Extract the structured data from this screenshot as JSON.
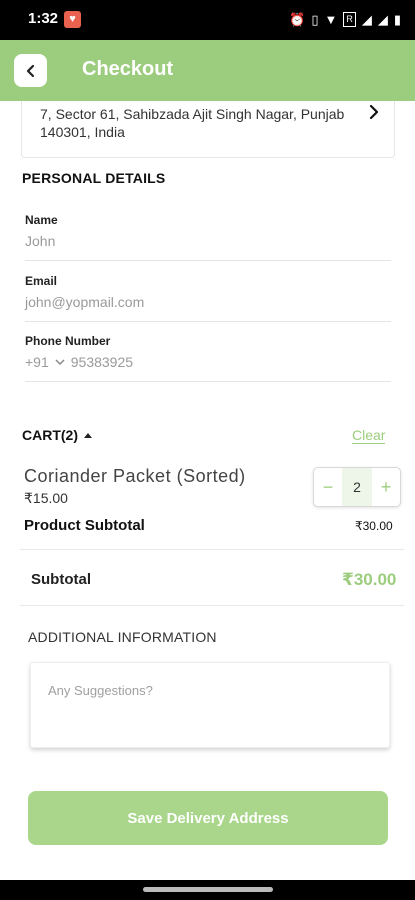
{
  "status_bar": {
    "time": "1:32",
    "network_label": "R"
  },
  "header": {
    "title": "Checkout"
  },
  "address": {
    "text": "7, Sector 61, Sahibzada Ajit Singh Nagar, Punjab 140301, India"
  },
  "personal": {
    "section_title": "PERSONAL DETAILS",
    "name_label": "Name",
    "name_value": "John",
    "email_label": "Email",
    "email_value": "john@yopmail.com",
    "phone_label": "Phone Number",
    "country_code": "+91",
    "phone_value": "95383925"
  },
  "cart": {
    "title": "CART(2)",
    "clear_label": "Clear",
    "item": {
      "name": "Coriander Packet (Sorted)",
      "price": "₹15.00",
      "quantity": "2",
      "minus": "−",
      "plus": "+"
    },
    "product_subtotal_label": "Product Subtotal",
    "product_subtotal_value": "₹30.00",
    "subtotal_label": "Subtotal",
    "subtotal_value": "₹30.00"
  },
  "additional": {
    "title": "ADDITIONAL INFORMATION",
    "placeholder": "Any Suggestions?"
  },
  "save_button": {
    "label": "Save Delivery Address"
  },
  "colors": {
    "accent": "#9ccd7e",
    "button": "#a9d68a"
  }
}
